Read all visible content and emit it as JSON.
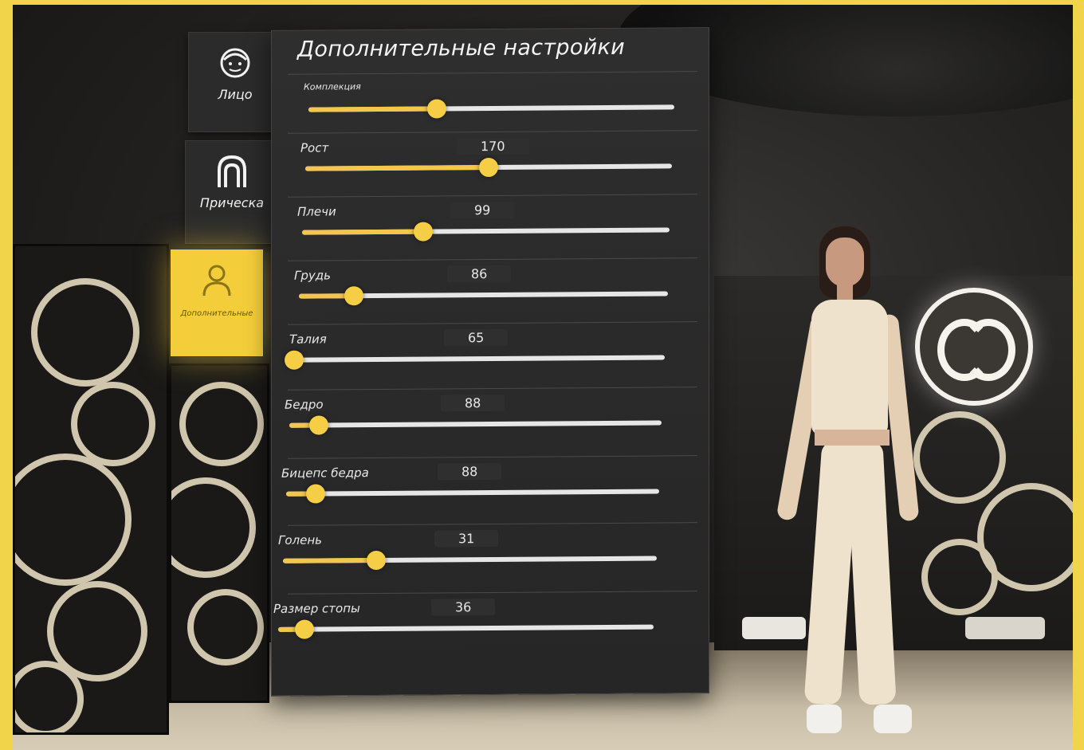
{
  "tabs": [
    {
      "label": "Лицо",
      "icon": "face-icon",
      "active": false
    },
    {
      "label": "Прическа",
      "icon": "hair-icon",
      "active": false
    },
    {
      "label": "Дополнительные",
      "icon": "person-icon",
      "active": true
    }
  ],
  "panel": {
    "title": "Дополнительные настройки",
    "sliders": [
      {
        "label": "Комплекция",
        "value": "",
        "fraction": 0.35
      },
      {
        "label": "Рост",
        "value": "170",
        "fraction": 0.5
      },
      {
        "label": "Плечи",
        "value": "99",
        "fraction": 0.33
      },
      {
        "label": "Грудь",
        "value": "86",
        "fraction": 0.15
      },
      {
        "label": "Талия",
        "value": "65",
        "fraction": 0.0
      },
      {
        "label": "Бедро",
        "value": "88",
        "fraction": 0.08
      },
      {
        "label": "Бицепс бедра",
        "value": "88",
        "fraction": 0.08
      },
      {
        "label": "Голень",
        "value": "31",
        "fraction": 0.25
      },
      {
        "label": "Размер стопы",
        "value": "36",
        "fraction": 0.07
      }
    ]
  },
  "colors": {
    "accent": "#f4cd3a",
    "frame": "#f2d44a",
    "panel": "#2b2b2b"
  }
}
